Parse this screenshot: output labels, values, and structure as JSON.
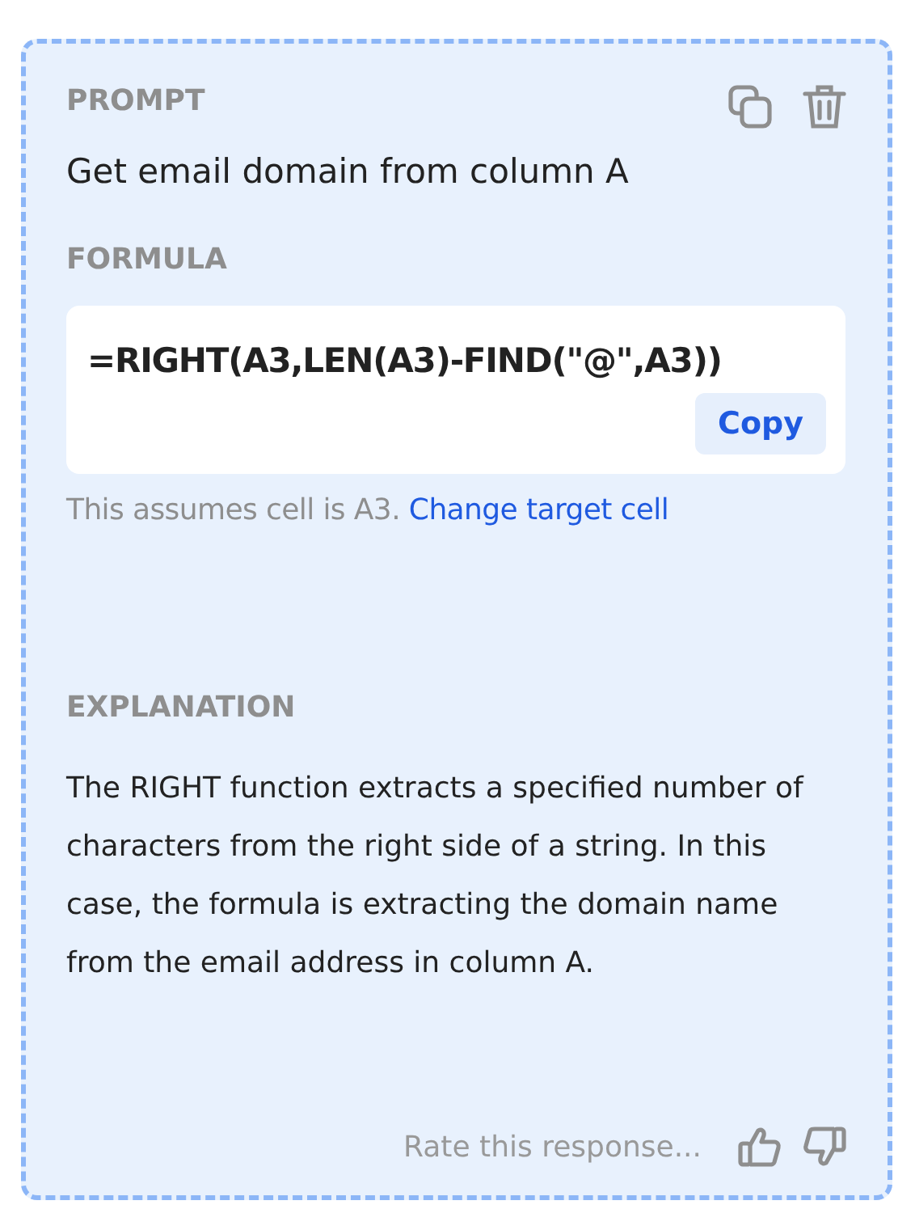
{
  "prompt": {
    "heading": "PROMPT",
    "text": "Get email domain from column A"
  },
  "formula": {
    "heading": "FORMULA",
    "code": "=RIGHT(A3,LEN(A3)-FIND(\"@\",A3))",
    "copy_button": "Copy",
    "note": "This assumes cell is A3.",
    "note_link": "Change target cell"
  },
  "explanation": {
    "heading": "EXPLANATION",
    "text": "The RIGHT function extracts a specified number of characters from the right side of a string. In this case, the formula is extracting the domain name from the email address in column A."
  },
  "footer": {
    "rate_label": "Rate this response..."
  }
}
